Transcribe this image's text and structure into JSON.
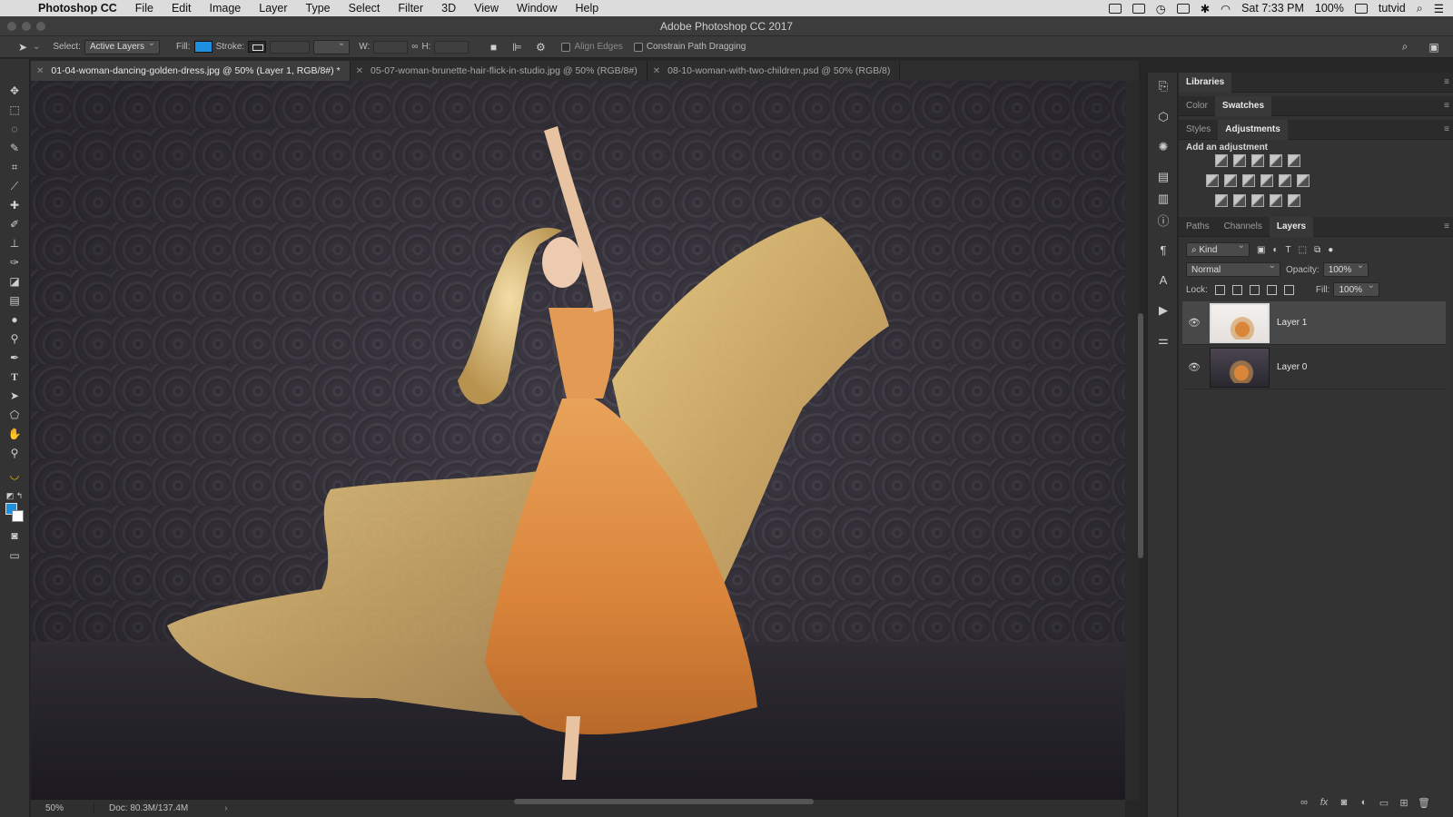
{
  "menubar": {
    "app_name": "Photoshop CC",
    "items": [
      "File",
      "Edit",
      "Image",
      "Layer",
      "Type",
      "Select",
      "Filter",
      "3D",
      "View",
      "Window",
      "Help"
    ],
    "clock": "Sat 7:33 PM",
    "battery": "100%",
    "user": "tutvid"
  },
  "window": {
    "title": "Adobe Photoshop CC 2017"
  },
  "options_bar": {
    "select_label": "Select:",
    "select_value": "Active Layers",
    "fill_label": "Fill:",
    "stroke_label": "Stroke:",
    "w_label": "W:",
    "h_label": "H:",
    "align_edges": "Align Edges",
    "constrain": "Constrain Path Dragging",
    "fill_color": "#1f8fe0"
  },
  "tabs": [
    {
      "label": "01-04-woman-dancing-golden-dress.jpg @ 50% (Layer 1, RGB/8#) *",
      "active": true
    },
    {
      "label": "05-07-woman-brunette-hair-flick-in-studio.jpg @ 50% (RGB/8#)",
      "active": false
    },
    {
      "label": "08-10-woman-with-two-children.psd @ 50% (RGB/8)",
      "active": false
    }
  ],
  "status": {
    "zoom": "50%",
    "doc": "Doc: 80.3M/137.4M",
    "arrow": "›"
  },
  "panels": {
    "libraries": "Libraries",
    "color_tabs": [
      "Color",
      "Swatches"
    ],
    "adj_tabs": [
      "Styles",
      "Adjustments"
    ],
    "add_adjustment": "Add an adjustment",
    "layer_tabs": [
      "Paths",
      "Channels",
      "Layers"
    ],
    "kind": "Kind",
    "blend_mode": "Normal",
    "opacity_label": "Opacity:",
    "opacity_value": "100%",
    "lock_label": "Lock:",
    "fill_label": "Fill:",
    "fill_value": "100%",
    "layers": [
      {
        "name": "Layer 1",
        "selected": true,
        "visible": true
      },
      {
        "name": "Layer 0",
        "selected": false,
        "visible": true
      }
    ]
  },
  "icons": {
    "toolbar": [
      "move-icon",
      "marquee-icon",
      "lasso-icon",
      "quick-select-icon",
      "crop-icon",
      "eyedropper-icon",
      "healing-icon",
      "brush-icon",
      "stamp-icon",
      "history-brush-icon",
      "eraser-icon",
      "gradient-icon",
      "blur-icon",
      "dodge-icon",
      "pen-icon",
      "type-icon",
      "path-select-icon",
      "shape-icon",
      "hand-icon",
      "zoom-icon",
      "banana-icon"
    ]
  }
}
